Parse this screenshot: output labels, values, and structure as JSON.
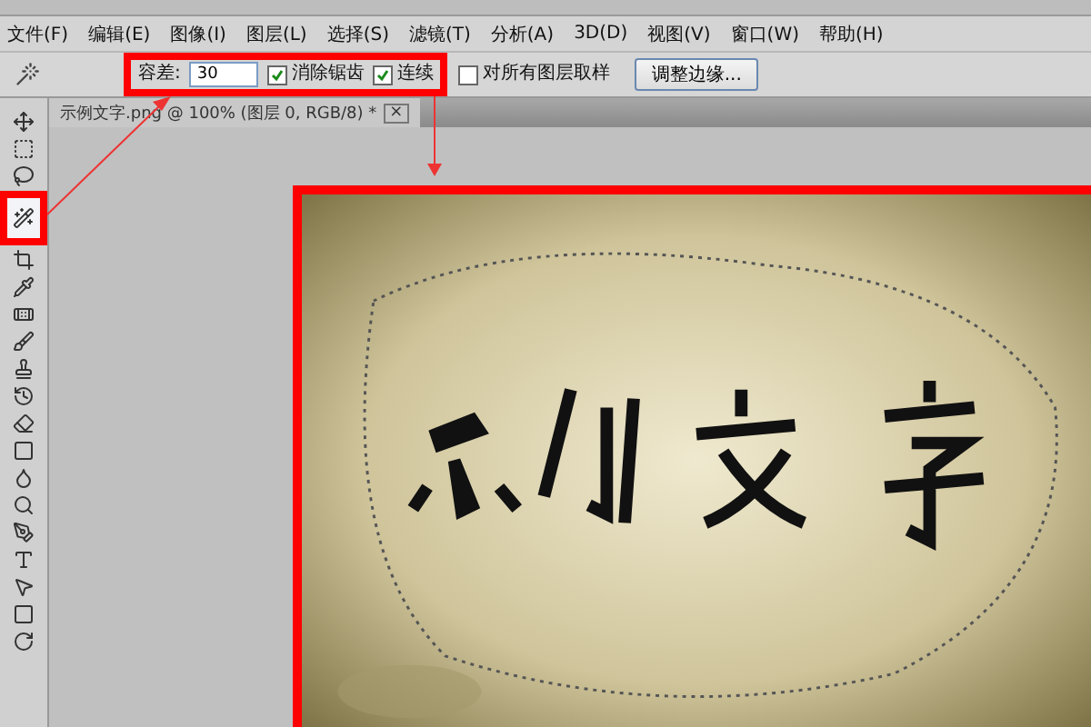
{
  "menu": [
    "文件(F)",
    "编辑(E)",
    "图像(I)",
    "图层(L)",
    "选择(S)",
    "滤镜(T)",
    "分析(A)",
    "3D(D)",
    "视图(V)",
    "窗口(W)",
    "帮助(H)"
  ],
  "options": {
    "tolerance_label": "容差:",
    "tolerance": "30",
    "checkboxes": [
      {
        "label": "消除锯齿",
        "checked": true
      },
      {
        "label": "连续",
        "checked": true
      },
      {
        "label": "对所有图层取样",
        "checked": false
      }
    ],
    "button": "调整边缘..."
  },
  "document_tab": {
    "title": "示例文字.png @ 100% (图层 0, RGB/8) *",
    "close": "×"
  },
  "tools": [
    {
      "kind": "move",
      "selected": false
    },
    {
      "kind": "marquee",
      "selected": false
    },
    {
      "kind": "lasso",
      "selected": false
    },
    {
      "kind": "wand",
      "selected": true
    },
    {
      "kind": "crop",
      "selected": false
    },
    {
      "kind": "eyedropper",
      "selected": false
    },
    {
      "kind": "heal",
      "selected": false
    },
    {
      "kind": "brush",
      "selected": false
    },
    {
      "kind": "stamp",
      "selected": false
    },
    {
      "kind": "history",
      "selected": false
    },
    {
      "kind": "eraser",
      "selected": false
    },
    {
      "kind": "gradient",
      "selected": false
    },
    {
      "kind": "blur",
      "selected": false
    },
    {
      "kind": "dodge",
      "selected": false
    },
    {
      "kind": "pen",
      "selected": false
    },
    {
      "kind": "type",
      "selected": false
    },
    {
      "kind": "select",
      "selected": false
    },
    {
      "kind": "shape",
      "selected": false
    },
    {
      "kind": "rotate",
      "selected": false
    }
  ]
}
